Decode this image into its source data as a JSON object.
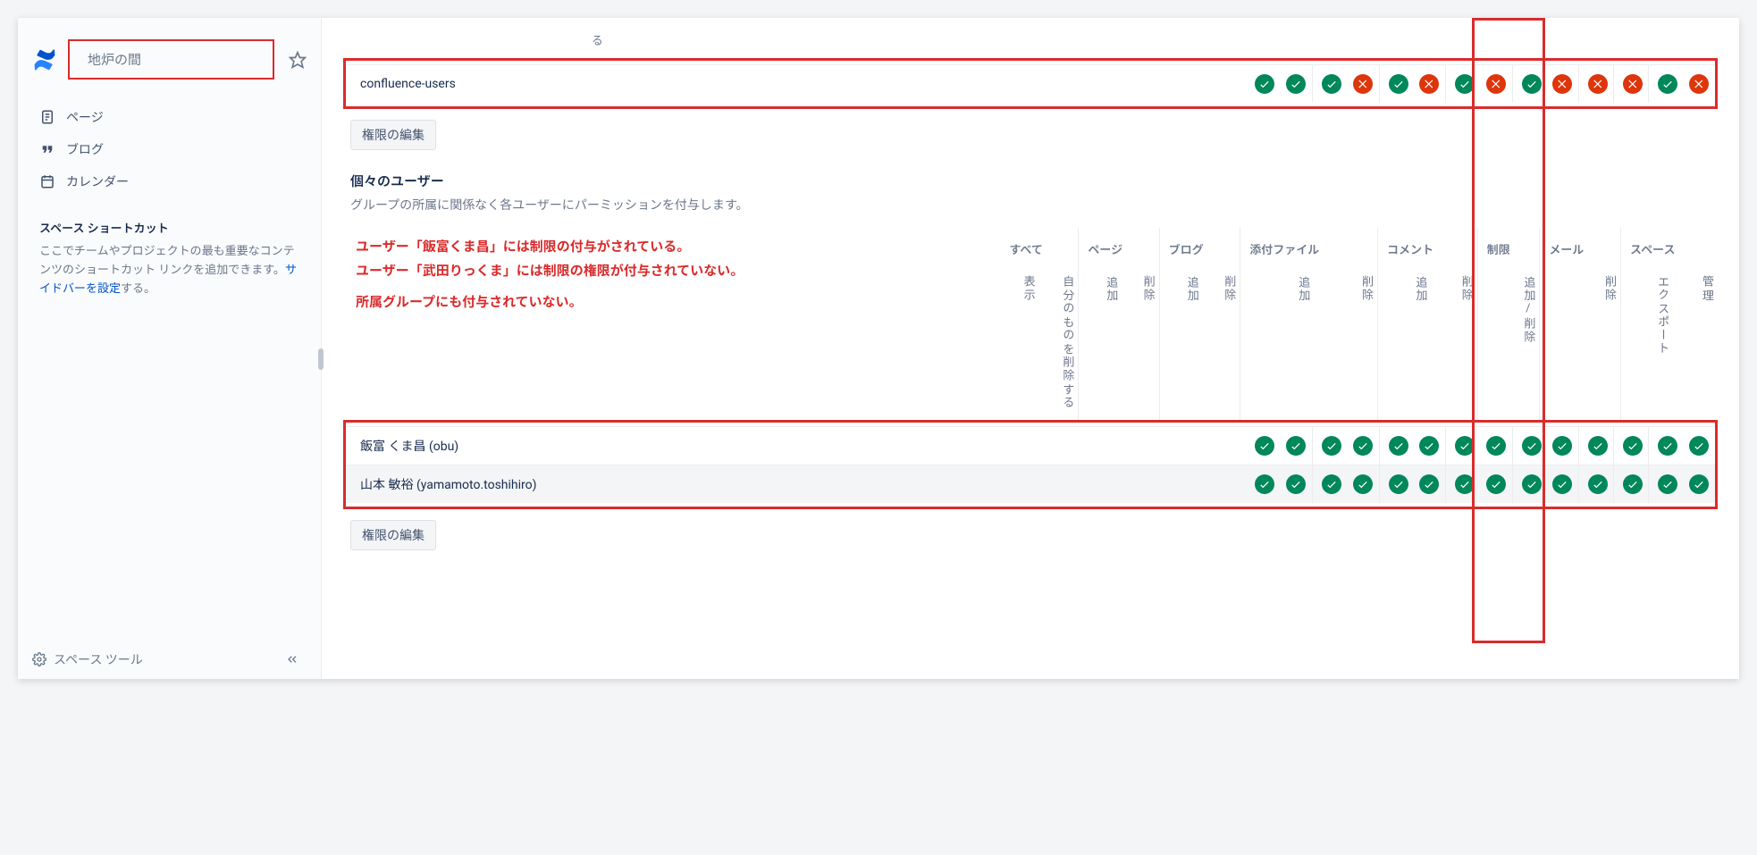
{
  "sidebar": {
    "space_name": "地炉の間",
    "nav": {
      "pages": "ページ",
      "blog": "ブログ",
      "calendar": "カレンダー"
    },
    "shortcuts": {
      "title": "スペース ショートカット",
      "text_prefix": "ここでチームやプロジェクトの最も重要なコンテンツのショートカット リンクを追加できます。",
      "link_text": "サイドバーを設定",
      "text_suffix": "する。"
    },
    "footer": "スペース ツール"
  },
  "main": {
    "groups": {
      "header_last": "る",
      "row_label": "confluence-users",
      "perms": [
        true,
        true,
        true,
        false,
        true,
        false,
        true,
        false,
        true,
        false,
        false,
        false,
        true,
        false
      ]
    },
    "edit_button": "権限の編集",
    "users_section": {
      "title": "個々のユーザー",
      "desc": "グループの所属に関係なく各ユーザーにパーミッションを付与します。"
    },
    "annotations": {
      "l1": "ユーザー「飯富くま昌」には制限の付与がされている。",
      "l2": "ユーザー「武田りっくま」には制限の権限が付与されていない。",
      "l3": "所属グループにも付与されていない。"
    },
    "cat_headers": {
      "all": "すべて",
      "page": "ページ",
      "blog": "ブログ",
      "attach": "添付ファイル",
      "comment": "コメント",
      "restrict": "制限",
      "mail": "メール",
      "space": "スペース"
    },
    "sub_headers": {
      "view": "表示",
      "delete_own": "自分のものを削除する",
      "add": "追加",
      "delete": "削除",
      "add_delete": "追加/削除",
      "export": "エクスポート",
      "admin": "管理"
    },
    "users": [
      {
        "name": "飯富 くま昌 (obu)",
        "alt": false,
        "perms": [
          true,
          true,
          true,
          true,
          true,
          true,
          true,
          true,
          true,
          true,
          true,
          true,
          true,
          true
        ]
      },
      {
        "name": "山本 敏裕 (yamamoto.toshihiro)",
        "alt": true,
        "perms": [
          true,
          true,
          true,
          true,
          true,
          true,
          true,
          true,
          true,
          true,
          true,
          true,
          true,
          true
        ]
      }
    ]
  }
}
